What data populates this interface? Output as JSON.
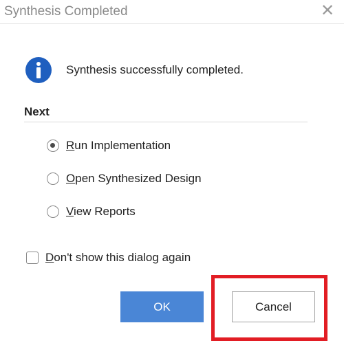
{
  "window": {
    "title": "Synthesis Completed",
    "close_glyph": "✕"
  },
  "message": {
    "icon": "info-icon",
    "text": "Synthesis successfully completed."
  },
  "next": {
    "label": "Next",
    "options": [
      {
        "mnemonic": "R",
        "rest": "un Implementation",
        "selected": true
      },
      {
        "mnemonic": "O",
        "rest": "pen Synthesized Design",
        "selected": false
      },
      {
        "mnemonic": "V",
        "rest": "iew Reports",
        "selected": false
      }
    ]
  },
  "dont_show": {
    "mnemonic": "D",
    "rest": "on't show this dialog again",
    "checked": false
  },
  "buttons": {
    "ok_label": "OK",
    "cancel_label": "Cancel"
  },
  "colors": {
    "accent": "#4a86d6",
    "info_icon": "#1f5fbf",
    "highlight": "#e21d24"
  }
}
